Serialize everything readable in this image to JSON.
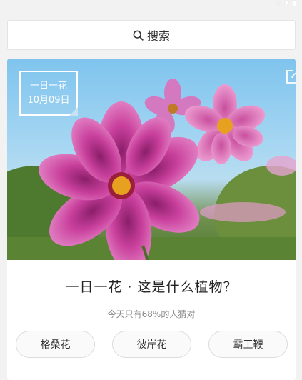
{
  "search": {
    "label": "搜索",
    "icon": "search-icon"
  },
  "card": {
    "stamp_title": "一日一花",
    "stamp_date": "10月09日",
    "share_icon": "share-icon",
    "question": "一日一花 · 这是什么植物？",
    "hint": "今天只有68%的人猜对",
    "options": [
      "格桑花",
      "彼岸花",
      "霸王鞭"
    ]
  },
  "colors": {
    "flower_petal": "#d65ab2",
    "flower_center": "#e8a020",
    "sky": "#8ccbef",
    "foliage": "#5b8a3a"
  }
}
